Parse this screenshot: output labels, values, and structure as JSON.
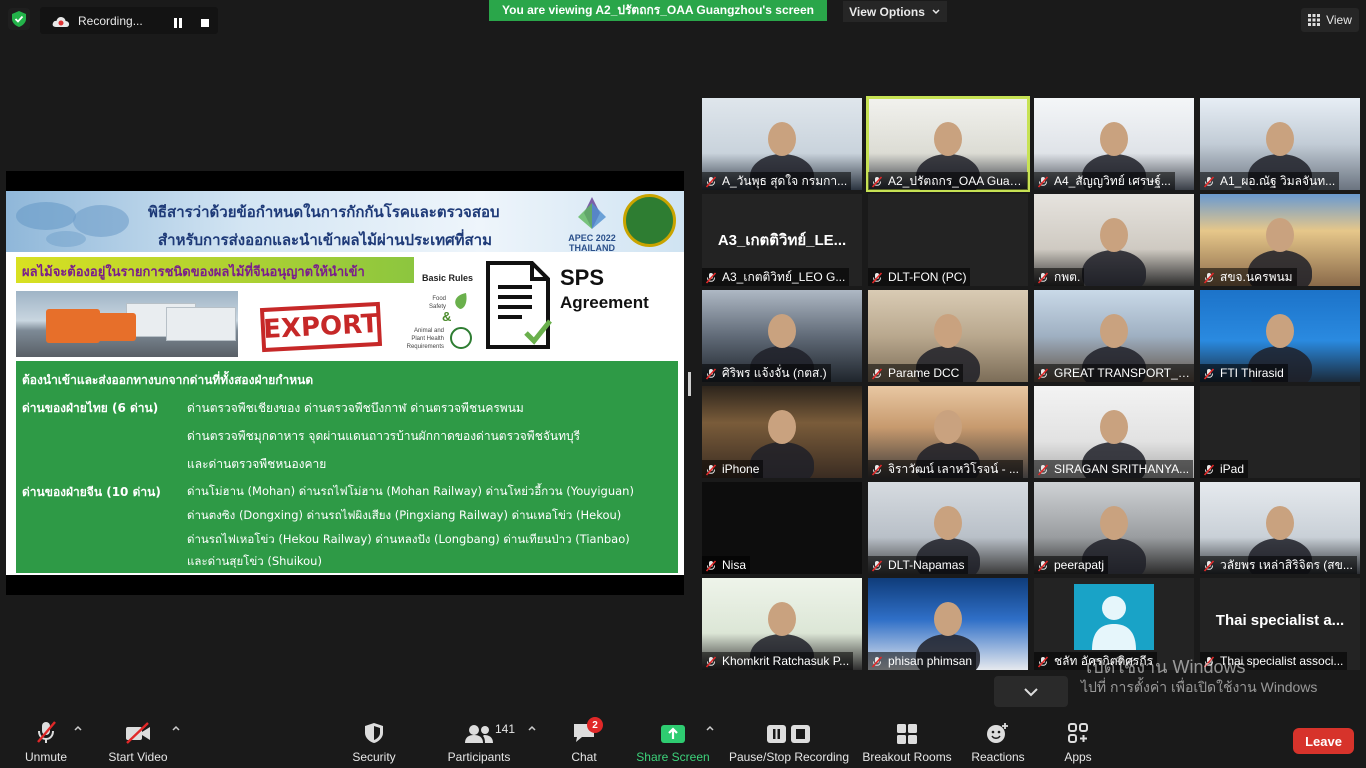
{
  "top": {
    "recording_label": "Recording...",
    "viewing_banner": "You are viewing A2_ปรัตถกร_OAA Guangzhou's screen",
    "view_options": "View Options",
    "view_button": "View"
  },
  "slide": {
    "title_line1": "พิธีสารว่าด้วยข้อกำหนดในการกักกันโรคและตรวจสอบ",
    "title_line2": "สำหรับการส่งออกและนำเข้าผลไม้ผ่านประเทศที่สาม",
    "apec_logo_text": "APEC 2022 THAILAND",
    "yellow_bar": "ผลไม้จะต้องอยู่ในรายการชนิดของผลไม้ที่จีนอนุญาตให้นำเข้า",
    "export_stamp": "EXPORT",
    "basic_rules": "Basic Rules",
    "food_safety": "Food Safety",
    "ampersand": "&",
    "animal_plant": "Animal and Plant Health Requirements",
    "sps_line1": "SPS",
    "sps_line2": "Agreement",
    "green_heading": "ต้องนำเข้าและส่งออกทางบกจากด่านที่ทั้งสองฝ่ายกำหนด",
    "thai_label": "ด่านของฝ่ายไทย (6 ด่าน)",
    "thai_line1": "ด่านตรวจพืชเชียงของ ด่านตรวจพืชบึงกาฬ ด่านตรวจพืชนครพนม",
    "thai_line2": "ด่านตรวจพืชมุกดาหาร จุดผ่านแดนถาวรบ้านผักกาดของด่านตรวจพืชจันทบุรี",
    "thai_line3": "และด่านตรวจพืชหนองคาย",
    "china_label": "ด่านของฝ่ายจีน (10 ด่าน)",
    "china_line1": "ด่านโม่ฮาน (Mohan) ด่านรถไฟโม่ฮาน (Mohan Railway) ด่านโหย่วอี้กวน (Youyiguan)",
    "china_line2": "ด่านตงซิง (Dongxing) ด่านรถไฟผิงเสียง (Pingxiang Railway) ด่านเหอโข่ว (Hekou)",
    "china_line3": "ด่านรถไฟเหอโข่ว (Hekou Railway) ด่านหลงปัง (Longbang) ด่านเทียนป่าว (Tianbao)",
    "china_line4": "และด่านสุยโข่ว (Shuikou)"
  },
  "gallery": {
    "tiles": [
      {
        "name": "A_วันพุธ สุดใจ กรมกา...",
        "mic": "muted"
      },
      {
        "name": "A2_ปรัตถกร_OAA Guan...",
        "mic": "muted"
      },
      {
        "name": "A4_สัญญวิทย์ เศรษฐ์...",
        "mic": "muted"
      },
      {
        "name": "A1_ผอ.ณัฐ วิมลจันท...",
        "mic": "muted"
      },
      {
        "name": "A3_เกตติวิทย์_LEO G...",
        "big": "A3_เกตติวิทย์_LE...",
        "mic": "muted"
      },
      {
        "name": "DLT-FON (PC)",
        "mic": "muted"
      },
      {
        "name": "กพต.",
        "mic": "muted"
      },
      {
        "name": "สขจ.นครพนม",
        "mic": "muted"
      },
      {
        "name": "ศิริพร แจ้งจั่น (กตส.)",
        "mic": "muted"
      },
      {
        "name": "Parame DCC",
        "mic": "muted"
      },
      {
        "name": "GREAT TRANSPORT_li...",
        "mic": "muted"
      },
      {
        "name": "FTI Thirasid",
        "mic": "muted"
      },
      {
        "name": "iPhone",
        "mic": "muted"
      },
      {
        "name": "จิราวัฒน์ เลาหวิโรจน์ - ...",
        "mic": "muted"
      },
      {
        "name": "SIRAGAN SRITHANYA...",
        "mic": "muted"
      },
      {
        "name": "iPad",
        "mic": "muted"
      },
      {
        "name": "Nisa",
        "mic": "muted"
      },
      {
        "name": "DLT-Napamas",
        "mic": "muted"
      },
      {
        "name": "peerapatj",
        "mic": "muted"
      },
      {
        "name": "วลัยพร เหล่าสิริจิตร (สข...",
        "mic": "muted"
      },
      {
        "name": "Khomkrit Ratchasuk P...",
        "mic": "muted"
      },
      {
        "name": "phisan phimsan",
        "mic": "muted"
      },
      {
        "name": "ชลัท อัครกิตติศรกีร",
        "mic": "muted"
      },
      {
        "name": "Thai specialist associ...",
        "big": "Thai specialist a...",
        "mic": "muted"
      }
    ]
  },
  "watermark": {
    "line1": "เปิดใช้งาน Windows",
    "line2": "ไปที่ การตั้งค่า เพื่อเปิดใช้งาน Windows"
  },
  "toolbar": {
    "unmute": "Unmute",
    "start_video": "Start Video",
    "security": "Security",
    "participants": "Participants",
    "participants_count": "141",
    "chat": "Chat",
    "chat_badge": "2",
    "share_screen": "Share Screen",
    "pause_stop": "Pause/Stop Recording",
    "breakout": "Breakout Rooms",
    "reactions": "Reactions",
    "apps": "Apps",
    "leave": "Leave"
  },
  "colors": {
    "banner_green": "#2aa64a",
    "active_speaker": "#c7e254",
    "leave_red": "#d7332b",
    "share_green": "#3cd27a",
    "slide_green": "#2e9a46"
  }
}
